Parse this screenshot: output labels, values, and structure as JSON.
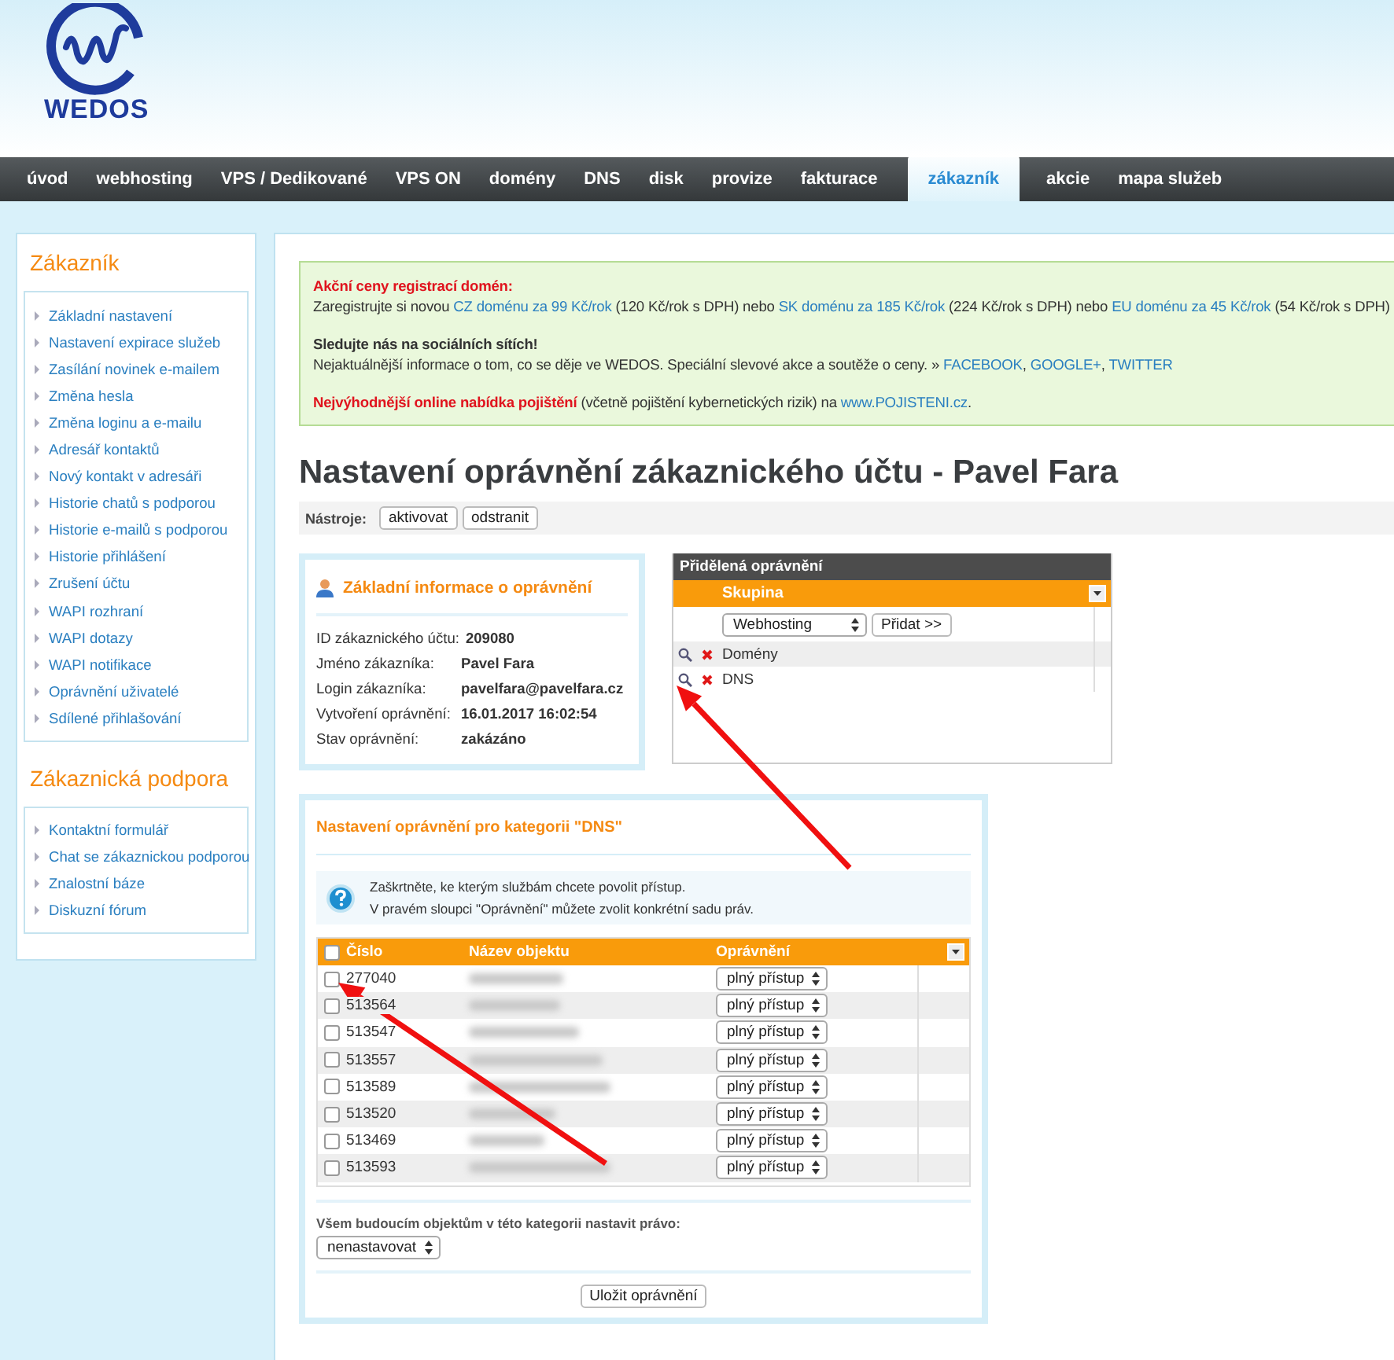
{
  "logo": {
    "text": "WEDOS"
  },
  "nav": [
    {
      "label": "úvod",
      "selected": false
    },
    {
      "label": "webhosting",
      "selected": false
    },
    {
      "label": "VPS / Dedikované",
      "selected": false
    },
    {
      "label": "VPS ON",
      "selected": false
    },
    {
      "label": "domény",
      "selected": false
    },
    {
      "label": "DNS",
      "selected": false
    },
    {
      "label": "disk",
      "selected": false
    },
    {
      "label": "provize",
      "selected": false
    },
    {
      "label": "fakturace",
      "selected": false
    },
    {
      "label": "zákazník",
      "selected": true
    },
    {
      "label": "akcie",
      "selected": false
    },
    {
      "label": "mapa služeb",
      "selected": false
    }
  ],
  "sidebar": [
    {
      "title": "Zákazník",
      "items": [
        "Základní nastavení",
        "Nastavení expirace služeb",
        "Zasílání novinek e-mailem",
        "Změna hesla",
        "Změna loginu a e-mailu",
        "Adresář kontaktů",
        "Nový kontakt v adresáři",
        "Historie chatů s podporou",
        "Historie e-mailů s podporou",
        "Historie přihlášení",
        "Zrušení účtu",
        "WAPI rozhraní",
        "WAPI dotazy",
        "WAPI notifikace",
        "Oprávnění uživatelé",
        "Sdílené přihlašování"
      ]
    },
    {
      "title": "Zákaznická podpora",
      "items": [
        "Kontaktní formulář",
        "Chat se zákaznickou podporou",
        "Znalostní báze",
        "Diskuzní fórum"
      ]
    }
  ],
  "notice": [
    {
      "heading": {
        "kind": "alert",
        "text": "Akční ceny registrací domén:"
      },
      "parts": [
        {
          "kind": "text",
          "text": "Zaregistrujte si novou "
        },
        {
          "kind": "link",
          "text": "CZ doménu za 99 Kč/rok"
        },
        {
          "kind": "text",
          "text": " (120 Kč/rok s DPH) nebo "
        },
        {
          "kind": "link",
          "text": "SK doménu za 185 Kč/rok"
        },
        {
          "kind": "text",
          "text": " (224 Kč/rok s DPH) nebo "
        },
        {
          "kind": "link",
          "text": "EU doménu za 45 Kč/rok"
        },
        {
          "kind": "text",
          "text": " (54 Kč/rok s DPH)"
        }
      ]
    },
    {
      "heading": {
        "kind": "plain",
        "text": "Sledujte nás na sociálních sítích!"
      },
      "parts": [
        {
          "kind": "text",
          "text": "Nejaktuálnější informace o tom, co se děje ve WEDOS. Speciální slevové akce a soutěže o ceny. » "
        },
        {
          "kind": "link",
          "text": "FACEBOOK"
        },
        {
          "kind": "text",
          "text": ", "
        },
        {
          "kind": "link",
          "text": "GOOGLE+"
        },
        {
          "kind": "text",
          "text": ", "
        },
        {
          "kind": "link",
          "text": "TWITTER"
        }
      ]
    },
    {
      "parts": [
        {
          "kind": "alert",
          "text": "Nejvýhodnější online nabídka pojištění"
        },
        {
          "kind": "text",
          "text": " (včetně pojištění kybernetických rizik) na "
        },
        {
          "kind": "link",
          "text": "www.POJISTENI.cz"
        },
        {
          "kind": "text",
          "text": "."
        }
      ]
    }
  ],
  "title": "Nastavení oprávnění zákaznického účtu - Pavel Fara",
  "tools": {
    "label": "Nástroje:",
    "buttons": [
      "aktivovat",
      "odstranit"
    ]
  },
  "info": {
    "title": "Základní informace o oprávnění",
    "rows": [
      {
        "label": "ID zákaznického účtu:",
        "value": "209080"
      },
      {
        "label": "Jméno zákazníka:",
        "value": "Pavel Fara"
      },
      {
        "label": "Login zákazníka:",
        "value": "pavelfara@pavelfara.cz"
      },
      {
        "label": "Vytvoření oprávnění:",
        "value": "16.01.2017 16:02:54"
      },
      {
        "label": "Stav oprávnění:",
        "value": "zakázáno"
      }
    ]
  },
  "assigned": {
    "title": "Přidělená oprávnění",
    "column": "Skupina",
    "select": "Webhosting",
    "add_button": "Přidat >>",
    "rows": [
      "Domény",
      "DNS"
    ]
  },
  "category": {
    "title": "Nastavení oprávnění pro kategorii \"DNS\"",
    "help": [
      "Zaškrtněte, ke kterým službám chcete povolit přístup.",
      "V pravém sloupci \"Oprávnění\" můžete zvolit konkrétní sadu práv."
    ],
    "columns": [
      "Číslo",
      "Název objektu",
      "Oprávnění"
    ],
    "all_checked": false,
    "rows": [
      {
        "number": "277040",
        "checked": false,
        "permission": "plný přístup"
      },
      {
        "number": "513564",
        "checked": false,
        "permission": "plný přístup"
      },
      {
        "number": "513547",
        "checked": false,
        "permission": "plný přístup"
      },
      {
        "number": "513557",
        "checked": false,
        "permission": "plný přístup"
      },
      {
        "number": "513589",
        "checked": false,
        "permission": "plný přístup"
      },
      {
        "number": "513520",
        "checked": false,
        "permission": "plný přístup"
      },
      {
        "number": "513469",
        "checked": false,
        "permission": "plný přístup"
      },
      {
        "number": "513593",
        "checked": false,
        "permission": "plný přístup"
      }
    ],
    "future_label": "Všem budoucím objektům v této kategorii nastavit právo:",
    "future_select": "nenastavovat",
    "save_button": "Uložit oprávnění"
  }
}
